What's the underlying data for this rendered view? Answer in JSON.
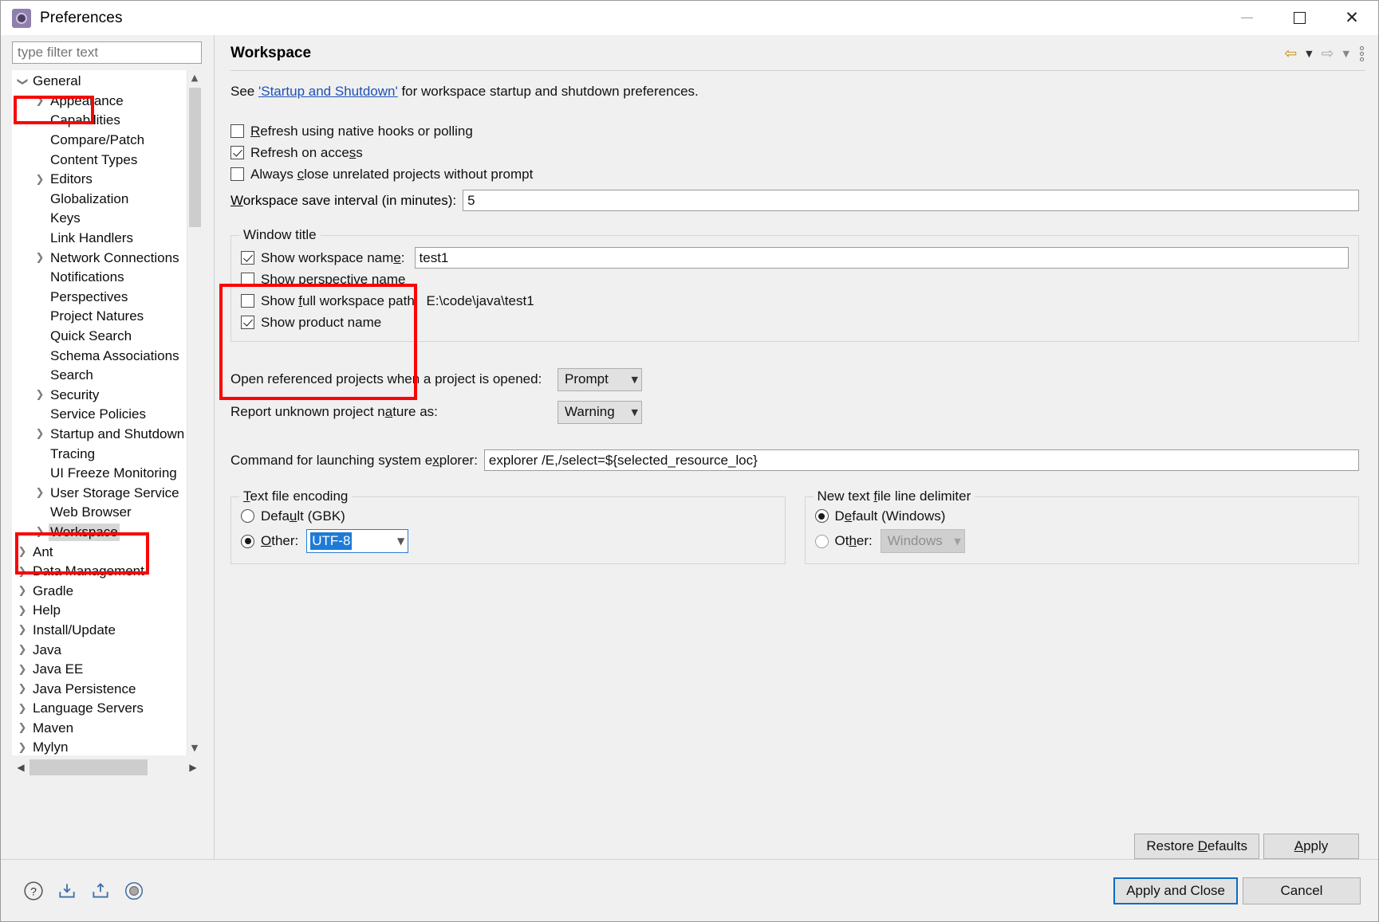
{
  "window": {
    "title": "Preferences",
    "icon": "preferences-gear-icon",
    "minimize_label": "Minimize",
    "maximize_label": "Maximize",
    "close_label": "Close"
  },
  "sidebar": {
    "filter": {
      "placeholder": "type filter text",
      "value": ""
    },
    "items": [
      {
        "label": "General",
        "level": 1,
        "arrow": "down",
        "highlighted": true
      },
      {
        "label": "Appearance",
        "level": 2,
        "arrow": "right"
      },
      {
        "label": "Capabilities",
        "level": 2,
        "arrow": "none"
      },
      {
        "label": "Compare/Patch",
        "level": 2,
        "arrow": "none"
      },
      {
        "label": "Content Types",
        "level": 2,
        "arrow": "none"
      },
      {
        "label": "Editors",
        "level": 2,
        "arrow": "right"
      },
      {
        "label": "Globalization",
        "level": 2,
        "arrow": "none"
      },
      {
        "label": "Keys",
        "level": 2,
        "arrow": "none"
      },
      {
        "label": "Link Handlers",
        "level": 2,
        "arrow": "none"
      },
      {
        "label": "Network Connections",
        "level": 2,
        "arrow": "right"
      },
      {
        "label": "Notifications",
        "level": 2,
        "arrow": "none"
      },
      {
        "label": "Perspectives",
        "level": 2,
        "arrow": "none"
      },
      {
        "label": "Project Natures",
        "level": 2,
        "arrow": "none"
      },
      {
        "label": "Quick Search",
        "level": 2,
        "arrow": "none"
      },
      {
        "label": "Schema Associations",
        "level": 2,
        "arrow": "none"
      },
      {
        "label": "Search",
        "level": 2,
        "arrow": "none"
      },
      {
        "label": "Security",
        "level": 2,
        "arrow": "right"
      },
      {
        "label": "Service Policies",
        "level": 2,
        "arrow": "none"
      },
      {
        "label": "Startup and Shutdown",
        "level": 2,
        "arrow": "right"
      },
      {
        "label": "Tracing",
        "level": 2,
        "arrow": "none"
      },
      {
        "label": "UI Freeze Monitoring",
        "level": 2,
        "arrow": "none"
      },
      {
        "label": "User Storage Service",
        "level": 2,
        "arrow": "right"
      },
      {
        "label": "Web Browser",
        "level": 2,
        "arrow": "none"
      },
      {
        "label": "Workspace",
        "level": 2,
        "arrow": "right",
        "selected": true,
        "highlighted": true
      },
      {
        "label": "Ant",
        "level": 1,
        "arrow": "right"
      },
      {
        "label": "Data Management",
        "level": 1,
        "arrow": "right"
      },
      {
        "label": "Gradle",
        "level": 1,
        "arrow": "right"
      },
      {
        "label": "Help",
        "level": 1,
        "arrow": "right"
      },
      {
        "label": "Install/Update",
        "level": 1,
        "arrow": "right"
      },
      {
        "label": "Java",
        "level": 1,
        "arrow": "right"
      },
      {
        "label": "Java EE",
        "level": 1,
        "arrow": "right"
      },
      {
        "label": "Java Persistence",
        "level": 1,
        "arrow": "right"
      },
      {
        "label": "Language Servers",
        "level": 1,
        "arrow": "right"
      },
      {
        "label": "Maven",
        "level": 1,
        "arrow": "right"
      },
      {
        "label": "Mylyn",
        "level": 1,
        "arrow": "right"
      }
    ],
    "scroll_up_icon": "chevron-up-icon",
    "scroll_down_icon": "chevron-down-icon",
    "scroll_left_icon": "chevron-left-icon",
    "scroll_right_icon": "chevron-right-icon"
  },
  "page": {
    "title": "Workspace",
    "nav": {
      "back_icon": "back-arrow-icon",
      "back_menu_icon": "caret-down-icon",
      "forward_icon": "forward-arrow-icon",
      "forward_menu_icon": "caret-down-icon",
      "overflow_icon": "vertical-dots-icon"
    },
    "see_prefix": "See ",
    "see_link": "'Startup and Shutdown'",
    "see_suffix": " for workspace startup and shutdown preferences.",
    "checkboxes": [
      {
        "label": "Refresh using native hooks or polling",
        "checked": false,
        "mnemonic": "R"
      },
      {
        "label": "Refresh on access",
        "checked": true,
        "mnemonic": "s"
      },
      {
        "label": "Always close unrelated projects without prompt",
        "checked": false,
        "mnemonic": "c"
      }
    ],
    "save_interval": {
      "label": "Workspace save interval (in minutes):",
      "value": "5"
    },
    "window_title_group": {
      "legend": "Window title",
      "show_workspace_name": {
        "label": "Show workspace name:",
        "checked": true,
        "value": "test1"
      },
      "show_perspective_name": {
        "label": "Show perspective name",
        "checked": false
      },
      "show_full_workspace_path": {
        "label": "Show full workspace path:",
        "checked": false,
        "value": "E:\\code\\java\\test1"
      },
      "show_product_name": {
        "label": "Show product name",
        "checked": true
      }
    },
    "open_referenced": {
      "label": "Open referenced projects when a project is opened:",
      "value": "Prompt"
    },
    "report_nature": {
      "label": "Report unknown project nature as:",
      "value": "Warning"
    },
    "command_explorer": {
      "label": "Command for launching system explorer:",
      "value": "explorer /E,/select=${selected_resource_loc}"
    },
    "text_file_encoding": {
      "legend": "Text file encoding",
      "default_label": "Default (GBK)",
      "default_selected": false,
      "other_label": "Other:",
      "other_selected": true,
      "other_value": "UTF-8"
    },
    "line_delimiter": {
      "legend": "New text file line delimiter",
      "default_label": "Default (Windows)",
      "default_selected": true,
      "other_label": "Other:",
      "other_selected": false,
      "other_value": "Windows",
      "other_disabled": true
    },
    "restore_defaults_label": "Restore Defaults",
    "apply_label": "Apply"
  },
  "footer": {
    "help_icon": "help-question-icon",
    "import_icon": "import-icon",
    "export_icon": "export-icon",
    "about_icon": "about-circle-icon",
    "apply_and_close_label": "Apply and Close",
    "cancel_label": "Cancel"
  },
  "colors": {
    "highlight_red": "#fb0404",
    "link_blue": "#1c52b5",
    "selection_blue": "#1e7ad6",
    "focus_blue": "#0a6cc4"
  }
}
